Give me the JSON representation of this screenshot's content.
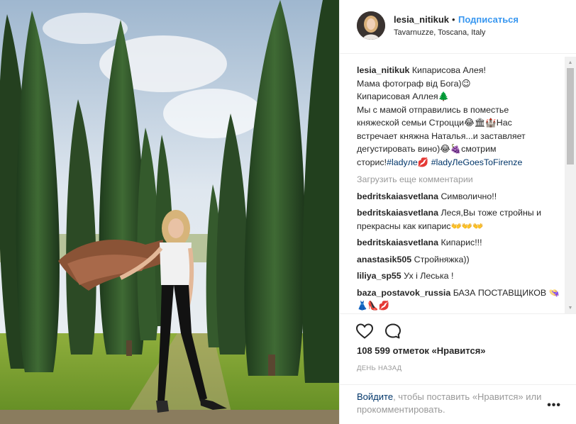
{
  "post": {
    "username": "lesia_nitikuk",
    "separator": "•",
    "follow_label": "Подписаться",
    "location": "Tavarnuzze, Toscana, Italy",
    "photo_alt": "photo",
    "avatar_alt": "avatar"
  },
  "caption": {
    "username": "lesia_nitikuk",
    "line1": "Кипарисова Алея!",
    "line2": "Мама фотограф від Бога)😉",
    "line3": "Кипарисовая Аллея🌲",
    "line4": "Мы с мамой отправились в поместье",
    "line5": "княжеской семьи Строцци😂🏛🏰Нас",
    "line6": "встречает княжна Наталья...и заставляет",
    "line7": "дегустировать вино)😂🍇смотрим",
    "line8_prefix": "сторис!",
    "tag1": "#ladyле💋",
    "tag2": "#ladyЛеGoesToFirenze"
  },
  "load_more_label": "Загрузить еще комментарии",
  "comments": [
    {
      "user": "bedritskaiasvetlana",
      "text": "Символично!!"
    },
    {
      "user": "bedritskaiasvetlana",
      "text": "Леся,Вы тоже стройны и прекрасны как кипарис👐👐👐"
    },
    {
      "user": "bedritskaiasvetlana",
      "text": "Кипарис!!!"
    },
    {
      "user": "anastasik505",
      "text": "Стройняжка))"
    },
    {
      "user": "liliya_sp55",
      "text": "Ух і Леська !"
    },
    {
      "user": "baza_postavok_russia",
      "text": "БАЗА ПОСТАВЩИКОВ 👒👗👠💋"
    }
  ],
  "likes_text": "108 599 отметок «Нравится»",
  "time_text": "ДЕНЬ НАЗАД",
  "login": {
    "link": "Войдите",
    "rest": ", чтобы поставить «Нравится» или прокомментировать."
  },
  "more_label": "•••",
  "icons": {
    "like": "heart-icon",
    "comment": "comment-bubble-icon",
    "scroll_up": "scroll-up-arrow-icon",
    "scroll_down": "scroll-down-arrow-icon",
    "more": "more-options-icon"
  },
  "colors": {
    "link_blue": "#3897f0",
    "tag_blue": "#003569",
    "muted": "#999999",
    "text": "#262626",
    "border": "#efefef"
  }
}
